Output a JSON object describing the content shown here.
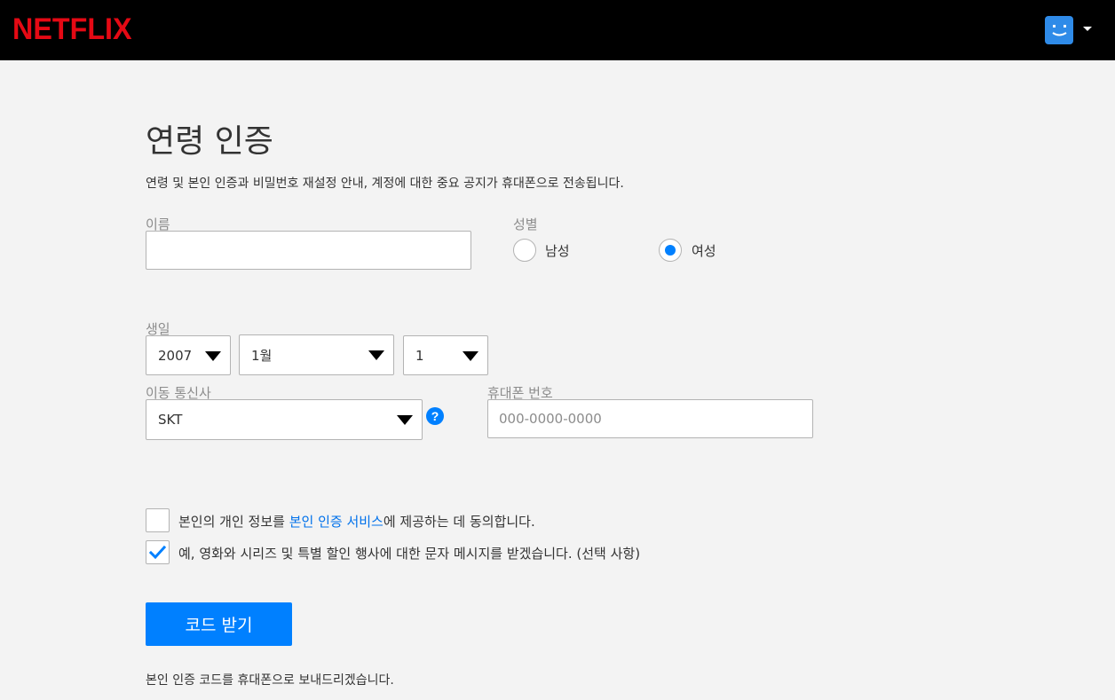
{
  "header": {
    "logo": "NETFLIX"
  },
  "page": {
    "title": "연령 인증",
    "description": "연령 및 본인 인증과 비밀번호 재설정 안내, 계정에 대한 중요 공지가 휴대폰으로 전송됩니다."
  },
  "form": {
    "name_label": "이름",
    "name_value": "",
    "gender_label": "성별",
    "gender_options": [
      {
        "label": "남성",
        "selected": false
      },
      {
        "label": "여성",
        "selected": true
      }
    ],
    "birthday_label": "생일",
    "birth_year": "2007",
    "birth_month": "1월",
    "birth_day": "1",
    "carrier_label": "이동 통신사",
    "carrier_value": "SKT",
    "help_icon_text": "?",
    "phone_label": "휴대폰 번호",
    "phone_placeholder": "000-0000-0000",
    "consent_before": "본인의 개인 정보를 ",
    "consent_link": "본인 인증 서비스",
    "consent_after": "에 제공하는 데 동의합니다.",
    "consent_checked": false,
    "sms_text": "예, 영화와 시리즈 및 특별 할인 행사에 대한 문자 메시지를 받겠습니다. (선택 사항)",
    "sms_checked": true,
    "submit_label": "코드 받기",
    "footnote": "본인 인증 코드를 휴대폰으로 보내드리겠습니다."
  },
  "colors": {
    "brand": "#e50914",
    "accent": "#0080ff",
    "link": "#0071eb"
  }
}
